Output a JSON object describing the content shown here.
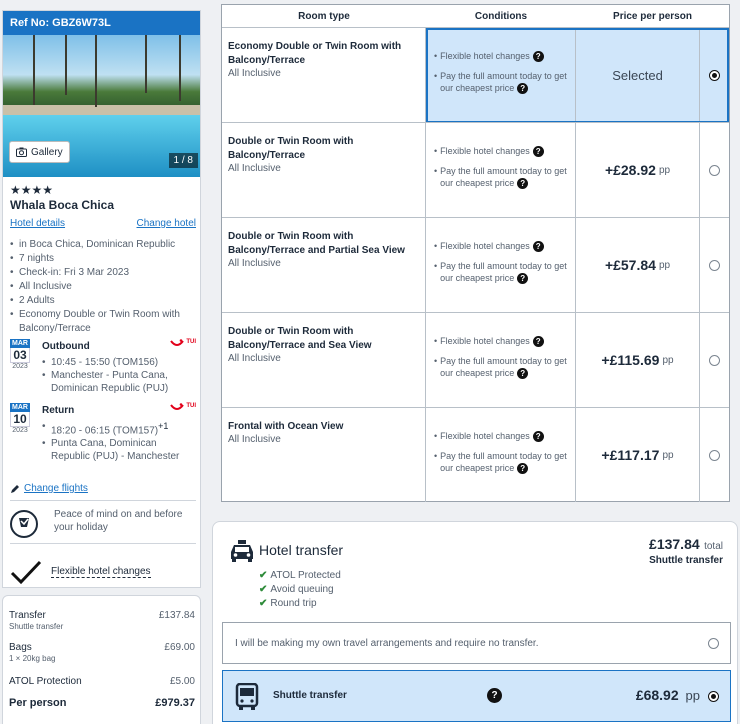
{
  "sidebar": {
    "ref": "Ref No: GBZ6W73L",
    "gallery_label": "Gallery",
    "photo_count": "1 / 8",
    "stars": "★★★★",
    "hotel_name": "Whala Boca Chica",
    "hotel_details_link": "Hotel details",
    "change_hotel_link": "Change hotel",
    "info": [
      "in Boca Chica, Dominican Republic",
      "7 nights",
      "Check-in: Fri 3 Mar 2023",
      "All Inclusive",
      "2 Adults",
      "Economy Double or Twin Room with Balcony/Terrace"
    ],
    "outbound": {
      "month": "MAR",
      "day": "03",
      "year": "2023",
      "title": "Outbound",
      "airline": "TUI",
      "lines": [
        "10:45 - 15:50 (TOM156)",
        "Manchester - Punta Cana, Dominican Republic (PUJ)"
      ]
    },
    "return": {
      "month": "MAR",
      "day": "10",
      "year": "2023",
      "title": "Return",
      "airline": "TUI",
      "lines": [
        "18:20 - 06:15 (TOM157)",
        "Punta Cana, Dominican Republic (PUJ) - Manchester"
      ],
      "day_offset": "+1"
    },
    "change_flights_link": "Change flights",
    "atol_text": "Peace of mind on and before your holiday",
    "flexible_text": "Flexible hotel changes"
  },
  "breakdown": {
    "rows": [
      {
        "label": "Transfer",
        "sub": "Shuttle transfer",
        "amount": "£137.84"
      },
      {
        "label": "Bags",
        "sub": "1 × 20kg bag",
        "amount": "£69.00"
      },
      {
        "label": "ATOL Protection",
        "sub": "",
        "amount": "£5.00"
      }
    ],
    "total_label": "Per person",
    "total_amount": "£979.37"
  },
  "room_table": {
    "headers": [
      "Room type",
      "Conditions",
      "Price per person"
    ],
    "condition_1": "Flexible hotel changes",
    "condition_2": "Pay the full amount today to get our cheapest price",
    "selected_label": "Selected",
    "pp": "pp",
    "rooms": [
      {
        "name": "Economy Double or Twin Room with Balcony/Terrace",
        "board": "All Inclusive",
        "price": "",
        "selected": true
      },
      {
        "name": "Double or Twin Room with Balcony/Terrace",
        "board": "All Inclusive",
        "price": "+£28.92",
        "selected": false
      },
      {
        "name": "Double or Twin Room with Balcony/Terrace and Partial Sea View",
        "board": "All Inclusive",
        "price": "+£57.84",
        "selected": false
      },
      {
        "name": "Double or Twin Room with Balcony/Terrace and Sea View",
        "board": "All Inclusive",
        "price": "+£115.69",
        "selected": false
      },
      {
        "name": "Frontal with Ocean View",
        "board": "All Inclusive",
        "price": "+£117.17",
        "selected": false
      }
    ]
  },
  "transfer": {
    "title": "Hotel transfer",
    "total_price": "£137.84",
    "total_label": "total",
    "type": "Shuttle transfer",
    "benefits": [
      "ATOL Protected",
      "Avoid queuing",
      "Round trip"
    ],
    "no_transfer_text": "I will be making my own travel arrangements and require no transfer.",
    "shuttle_label": "Shuttle transfer",
    "shuttle_price": "£68.92",
    "shuttle_pp": "pp"
  },
  "colors": {
    "accent": "#1a73c4",
    "selected_bg": "#d0e6fa",
    "check_green": "#2e8b3a",
    "tui_red": "#e2001a"
  }
}
